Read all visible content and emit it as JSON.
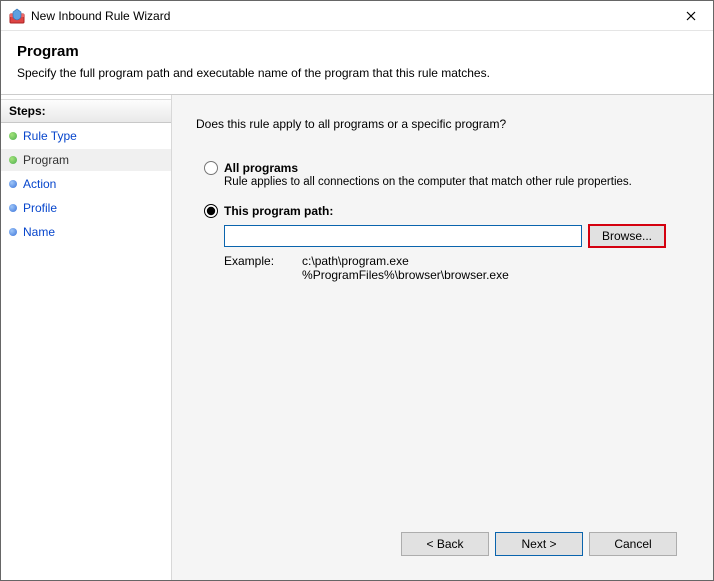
{
  "window": {
    "title": "New Inbound Rule Wizard"
  },
  "header": {
    "title": "Program",
    "subtitle": "Specify the full program path and executable name of the program that this rule matches."
  },
  "steps": {
    "title": "Steps:",
    "items": [
      {
        "label": "Rule Type",
        "state": "done"
      },
      {
        "label": "Program",
        "state": "current"
      },
      {
        "label": "Action",
        "state": "pending"
      },
      {
        "label": "Profile",
        "state": "pending"
      },
      {
        "label": "Name",
        "state": "pending"
      }
    ]
  },
  "content": {
    "prompt": "Does this rule apply to all programs or a specific program?",
    "option_all": {
      "label": "All programs",
      "desc": "Rule applies to all connections on the computer that match other rule properties."
    },
    "option_path": {
      "label": "This program path:",
      "input_value": "",
      "browse_label": "Browse...",
      "example_label": "Example:",
      "example_paths": "c:\\path\\program.exe\n%ProgramFiles%\\browser\\browser.exe"
    },
    "selected": "path"
  },
  "footer": {
    "back": "< Back",
    "next": "Next >",
    "cancel": "Cancel"
  }
}
